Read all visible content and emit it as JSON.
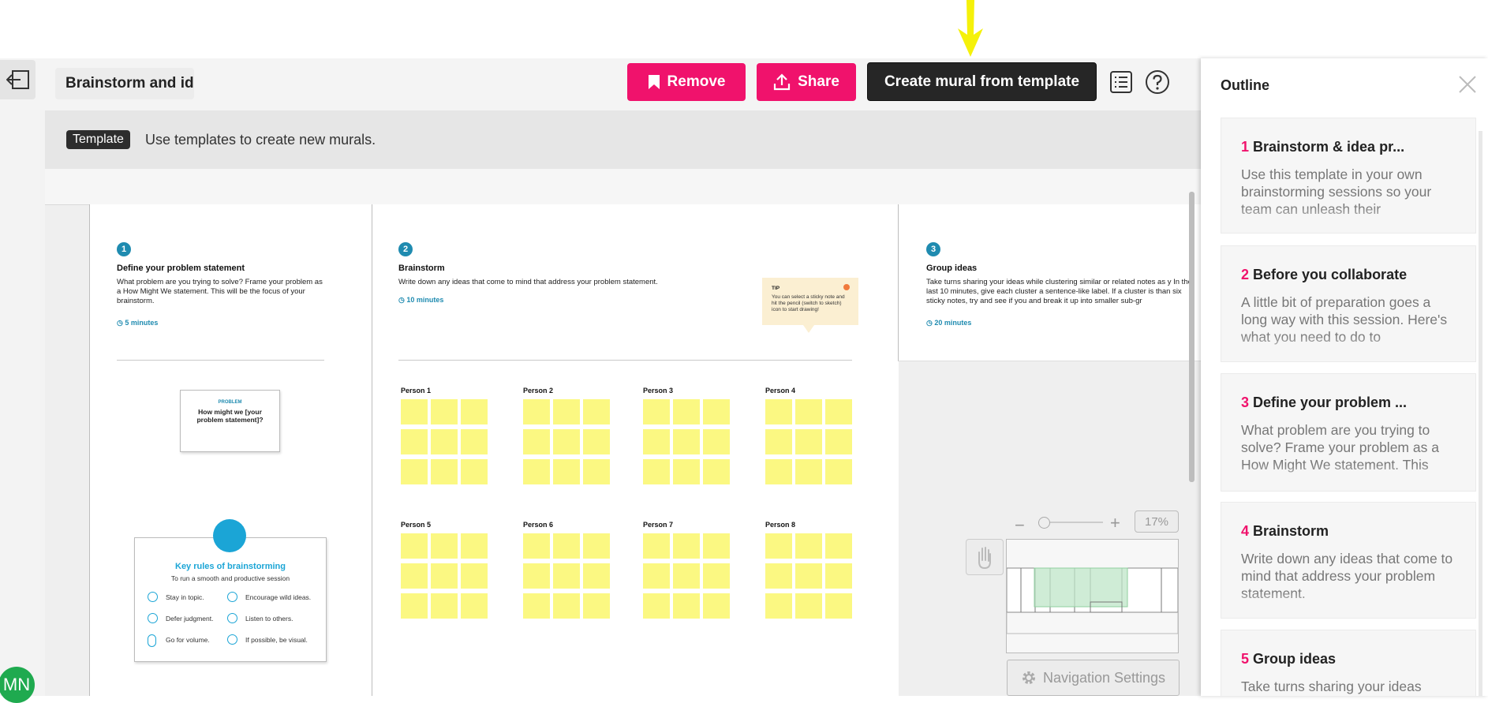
{
  "header": {
    "title": "Brainstorm and ide...",
    "remove_label": "Remove",
    "share_label": "Share",
    "create_label": "Create mural from template"
  },
  "template_bar": {
    "tag": "Template",
    "description": "Use templates to create new murals."
  },
  "user": {
    "initials": "MN"
  },
  "mural": {
    "sections": [
      {
        "number": "1",
        "title": "Define your problem statement",
        "description": "What problem are you trying to solve? Frame your problem as a How Might We statement. This will be the focus of your brainstorm.",
        "time": "5 minutes"
      },
      {
        "number": "2",
        "title": "Brainstorm",
        "description": "Write down any ideas that come to mind that address your problem statement.",
        "time": "10 minutes"
      },
      {
        "number": "3",
        "title": "Group ideas",
        "description": "Take turns sharing your ideas while clustering similar or related notes as y In the last 10 minutes, give each cluster a sentence-like label. If a cluster is than six sticky notes, try and see if you and break it up into smaller sub-gr",
        "time": "20 minutes"
      }
    ],
    "problem_card": {
      "label": "PROBLEM",
      "text": "How might we [your problem statement]?"
    },
    "rules": {
      "title": "Key rules of brainstorming",
      "subtitle": "To run a smooth and productive session",
      "items": [
        "Stay in topic.",
        "Encourage wild ideas.",
        "Defer judgment.",
        "Listen to others.",
        "Go for volume.",
        "If possible, be visual."
      ]
    },
    "tip": {
      "label": "TIP",
      "text": "You can select a sticky note and hit the pencil (switch to sketch) icon to start drawing!"
    },
    "persons": [
      "Person 1",
      "Person 2",
      "Person 3",
      "Person 4",
      "Person 5",
      "Person 6",
      "Person 7",
      "Person 8"
    ]
  },
  "zoom": {
    "level": "17%",
    "minus": "−",
    "plus": "+"
  },
  "nav_settings": "Navigation Settings",
  "outline": {
    "title": "Outline",
    "items": [
      {
        "number": "1",
        "title": "Brainstorm  & idea pr...",
        "description": "Use this template in your own brainstorming sessions so your team can unleash their"
      },
      {
        "number": "2",
        "title": "Before you collaborate",
        "description": "A little bit of preparation goes a long way with this session. Here's what you need to do to"
      },
      {
        "number": "3",
        "title": "Define your problem ...",
        "description": "What problem are you trying to solve? Frame your problem as a How Might We statement. This"
      },
      {
        "number": "4",
        "title": "Brainstorm",
        "description": "Write down any ideas that come to mind that address your problem statement."
      },
      {
        "number": "5",
        "title": "Group ideas",
        "description": "Take turns sharing your ideas"
      }
    ]
  },
  "colors": {
    "accent": "#f0126c",
    "dark": "#262626",
    "sticky": "#fbf882",
    "teal": "#1f8bb0",
    "highlight": "#f5f10a"
  }
}
